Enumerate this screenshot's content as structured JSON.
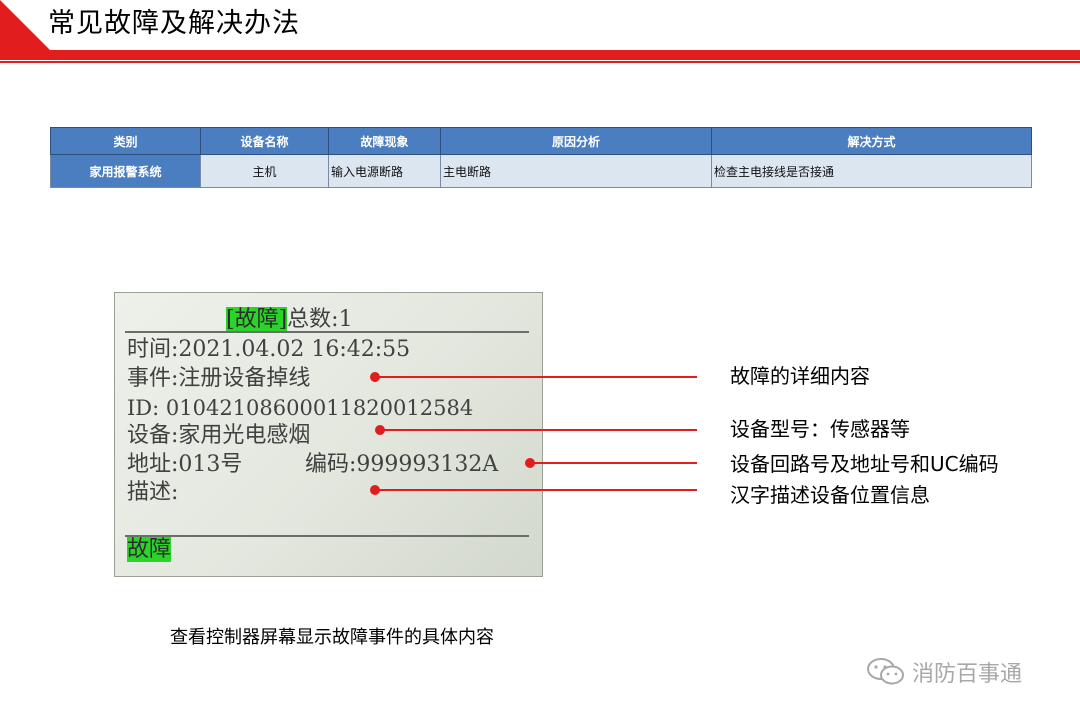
{
  "header": {
    "title": "常见故障及解决办法"
  },
  "table": {
    "headers": [
      "类别",
      "设备名称",
      "故障现象",
      "原因分析",
      "解决方式"
    ],
    "row": [
      "家用报警系统",
      "主机",
      "输入电源断路",
      "主电断路",
      "检查主电接线是否接通"
    ]
  },
  "lcd": {
    "tag": "[故障]",
    "total": "总数:1",
    "time": "时间:2021.04.02 16:42:55",
    "event": "事件:注册设备掉线",
    "id": "ID: 01042108600011820012584",
    "device": "设备:家用光电感烟",
    "address": "地址:013号",
    "code": "编码:999993132A",
    "desc": "描述:",
    "status": "故障"
  },
  "annotations": [
    "故障的详细内容",
    "设备型号：传感器等",
    "设备回路号及地址号和UC编码",
    "汉字描述设备位置信息"
  ],
  "colors": {
    "accent": "#e11d1d",
    "table_header": "#4a7ec0",
    "table_cell": "#dce6f1",
    "lcd_highlight": "#2bd32b"
  },
  "caption": "查看控制器屏幕显示故障事件的具体内容",
  "brand": {
    "name": "消防百事通",
    "icon": "wechat-icon"
  }
}
